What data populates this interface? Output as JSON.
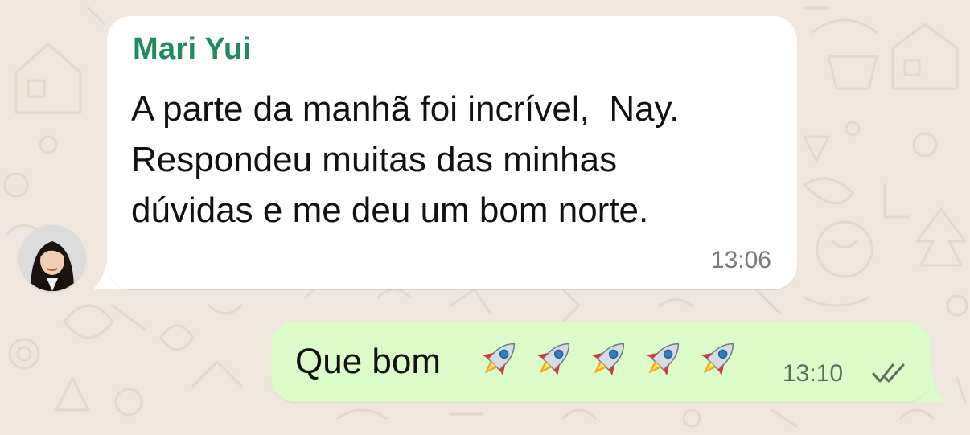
{
  "incoming": {
    "sender": "Mari Yui",
    "text": "A parte da manhã foi incrível,  Nay.\nRespondeu muitas das minhas\ndúvidas e me deu um bom norte.",
    "time": "13:06",
    "avatar_icon": "avatar-photo",
    "sender_color": "#1f8a5a"
  },
  "outgoing": {
    "text": "Que bom",
    "emoji": [
      "🚀",
      "🚀",
      "🚀",
      "🚀",
      "🚀"
    ],
    "time": "13:10",
    "status_icon": "double-check-icon",
    "bubble_color": "#dbfbc8"
  },
  "theme": {
    "wallpaper_color": "#efe7de",
    "incoming_bubble": "#ffffff"
  }
}
